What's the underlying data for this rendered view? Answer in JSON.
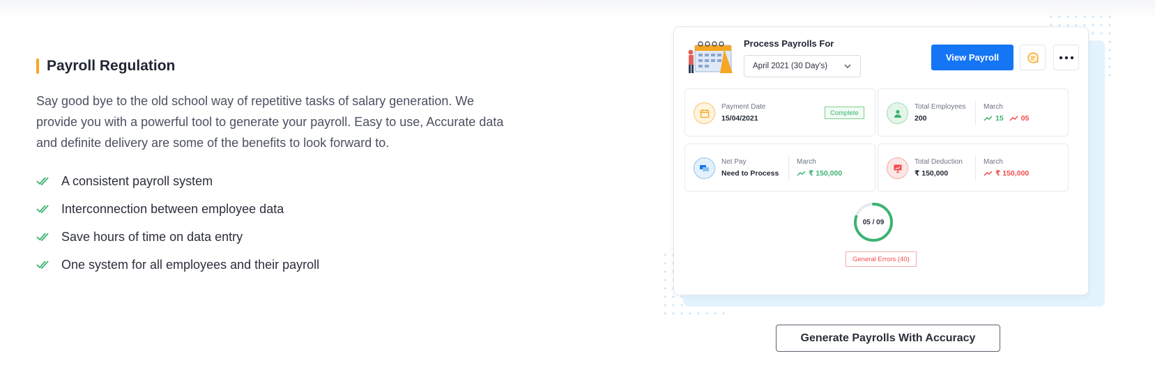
{
  "section": {
    "title": "Payroll Regulation",
    "description": "Say good bye to the old school way of repetitive tasks of salary generation. We provide you with a powerful tool to generate your payroll. Easy to use, Accurate data and definite delivery are some of the benefits to look forward to.",
    "features": [
      "A consistent payroll system",
      "Interconnection between employee data",
      "Save hours of time on data entry",
      "One system for all employees and their payroll"
    ]
  },
  "dashboard": {
    "process_label": "Process Payrolls For",
    "month_selected": "April 2021 (30 Day's)",
    "view_button": "View Payroll",
    "payment": {
      "label": "Payment Date",
      "value": "15/04/2021",
      "status": "Complete"
    },
    "employees": {
      "label": "Total Employees",
      "value": "200",
      "month_label": "March",
      "up": "15",
      "down": "05"
    },
    "net_pay": {
      "label": "Net Pay",
      "value": "Need to Process",
      "month_label": "March",
      "amount": "₹ 150,000"
    },
    "deduction": {
      "label": "Total Deduction",
      "value": "₹ 150,000",
      "month_label": "March",
      "amount": "₹ 150,000"
    },
    "progress": {
      "text": "05 / 09",
      "fraction": 0.8
    },
    "errors": "General Errors (40)"
  },
  "cta": "Generate Payrolls With Accuracy",
  "colors": {
    "accent": "#f5a623",
    "primary": "#1476f5",
    "success": "#3cb371",
    "danger": "#f24b4b",
    "light_blue": "#e3f3fd"
  },
  "icons": [
    "double-check-icon",
    "calendar-illustration-icon",
    "chevron-down-icon",
    "chat-icon",
    "more-icon",
    "calendar-icon",
    "person-icon",
    "money-icon",
    "presentation-icon",
    "trend-up-icon",
    "trend-down-icon"
  ]
}
